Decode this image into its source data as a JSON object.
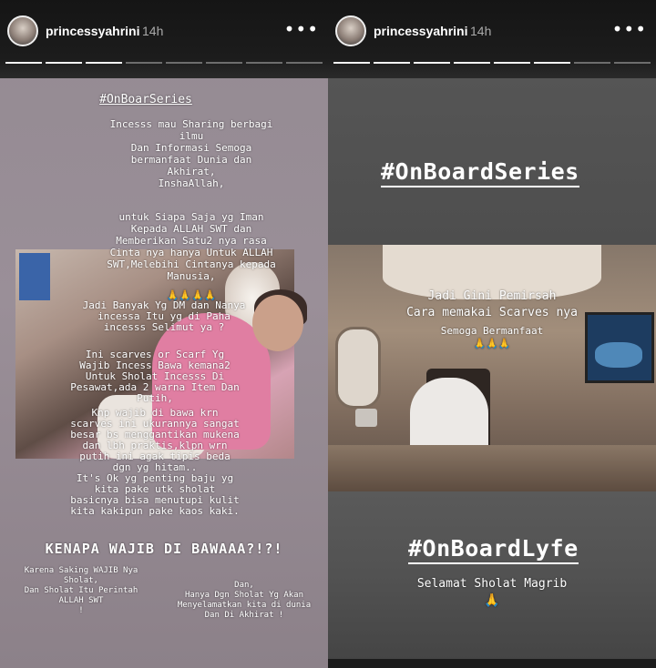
{
  "stories": [
    {
      "username": "princessyahrini",
      "time": "14h",
      "more_icon": "more-options-icon",
      "progress": {
        "total": 8,
        "completed": 2,
        "current": 3
      },
      "hashtag": "#OnBoarSeries",
      "paragraph1": "Incesss mau Sharing berbagi\nilmu\nDan Informasi Semoga\nbermanfaat Dunia dan\nAkhirat,\nInshaAllah,",
      "paragraph2": "untuk Siapa Saja yg Iman\nKepada ALLAH SWT dan\nMemberikan Satu2 nya rasa\nCinta nya hanya Untuk ALLAH\nSWT,Melebihi Cintanya kepada\nManusia,",
      "emoji1": "🙏🙏🙏🙏",
      "paragraph3": "Jadi Banyak Yg DM dan Nanya\nincessa Itu yg di Paha\nincesss Selimut ya ?",
      "paragraph4": "Ini scarves or Scarf Yg\nWajib Incess Bawa kemana2\nUntuk Sholat Incesss Di\nPesawat,ada 2 warna Item Dan\nPutih,",
      "paragraph5": "Knp wajib di bawa krn\nscarves ini ukurannya sangat\nbesar bs menggantikan mukena\ndan lbh praktis,klpn wrn\nputih ini agak tipis beda\ndgn yg hitam..\nIt's Ok yg penting baju yg\nkita pake utk sholat\nbasicnya bisa menutupi kulit\nkita kakipun pake kaos kaki.",
      "headline": "KENAPA WAJIB DI BAWAAA?!?!",
      "note_left": "Karena Saking WAJIB Nya\nSholat,\nDan Sholat Itu Perintah\nALLAH SWT\n!",
      "note_right": "Dan,\nHanya Dgn Sholat Yg Akan\nMenyelamatkan kita di dunia\nDan Di Akhirat !"
    },
    {
      "username": "princessyahrini",
      "time": "14h",
      "more_icon": "more-options-icon",
      "progress": {
        "total": 8,
        "completed": 5,
        "current": 6
      },
      "hashtag_top": "#OnBoardSeries",
      "overlay_line1": "Jadi Gini Pemirsah",
      "overlay_line2": "Cara memakai Scarves nya",
      "overlay_line3": "Semoga Bermanfaat",
      "emoji2": "🙏🙏🙏",
      "hashtag_bottom": "#OnBoardLyfe",
      "closing": "Selamat Sholat Magrib",
      "emoji3": "🙏"
    }
  ],
  "colors": {
    "bar": "#151515",
    "left_bg": "#948a92",
    "right_bg": "#525252",
    "emoji": "#d6a432"
  }
}
